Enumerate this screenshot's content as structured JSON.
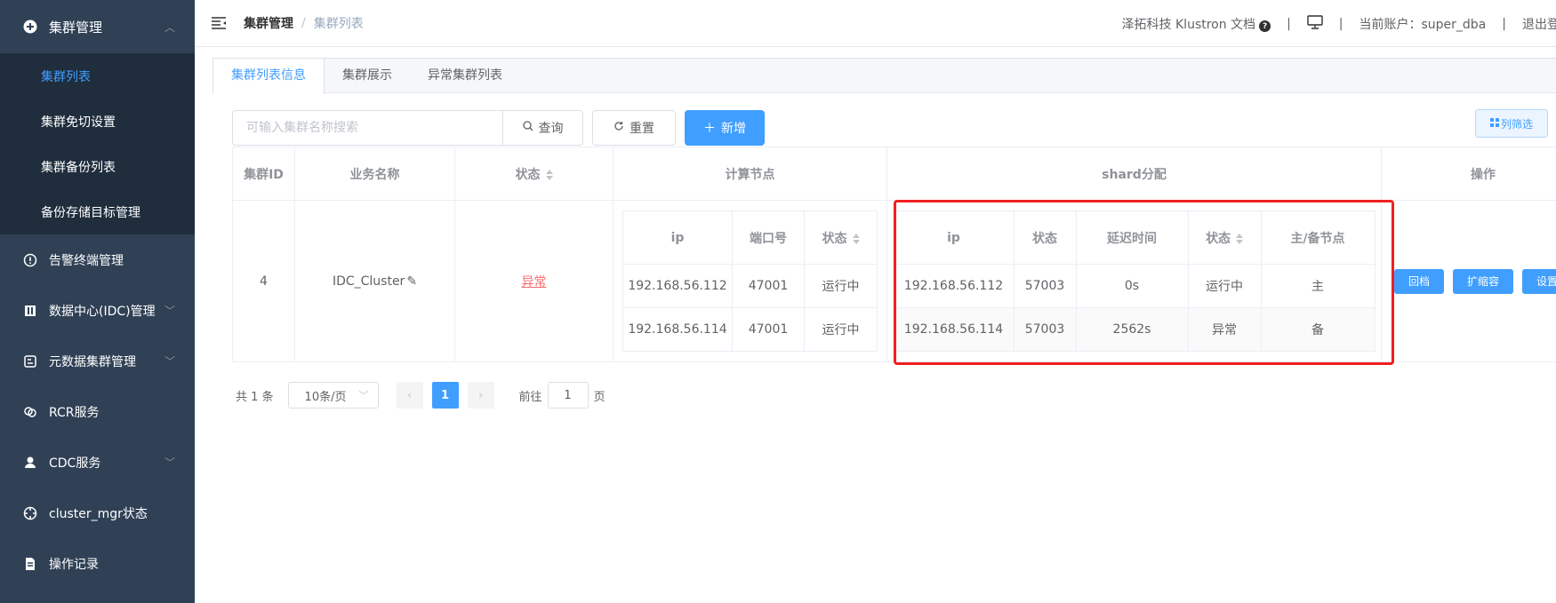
{
  "sidebar": {
    "groups": [
      {
        "label": "集群管理",
        "icon": "plus-circle-icon",
        "expanded": true,
        "items": [
          {
            "label": "集群列表",
            "active": true
          },
          {
            "label": "集群免切设置"
          },
          {
            "label": "集群备份列表"
          },
          {
            "label": "备份存储目标管理"
          }
        ]
      }
    ],
    "main_items": [
      {
        "label": "告警终端管理",
        "icon": "alert-circle-icon",
        "has_chevron": false
      },
      {
        "label": "数据中心(IDC)管理",
        "icon": "building-icon",
        "has_chevron": true
      },
      {
        "label": "元数据集群管理",
        "icon": "database-icon",
        "has_chevron": true
      },
      {
        "label": "RCR服务",
        "icon": "link-icon",
        "has_chevron": false
      },
      {
        "label": "CDC服务",
        "icon": "user-icon",
        "has_chevron": true
      },
      {
        "label": "cluster_mgr状态",
        "icon": "target-icon",
        "has_chevron": false
      },
      {
        "label": "操作记录",
        "icon": "document-icon",
        "has_chevron": false
      }
    ]
  },
  "header": {
    "breadcrumb": {
      "parent": "集群管理",
      "separator": "/",
      "current": "集群列表"
    },
    "docs_label": "泽拓科技 Klustron 文档",
    "account_label": "当前账户：super_dba",
    "logout_label": "退出登录",
    "sep": "|"
  },
  "tabs": [
    {
      "label": "集群列表信息",
      "active": true
    },
    {
      "label": "集群展示"
    },
    {
      "label": "异常集群列表"
    }
  ],
  "toolbar": {
    "search_placeholder": "可输入集群名称搜索",
    "query_label": "查询",
    "reset_label": "重置",
    "add_label": "新增",
    "filter_label": "列筛选"
  },
  "table": {
    "headers": {
      "cluster_id": "集群ID",
      "business_name": "业务名称",
      "status": "状态",
      "compute_nodes": "计算节点",
      "shard": "shard分配",
      "operations": "操作"
    },
    "compute_headers": {
      "ip": "ip",
      "port": "端口号",
      "status": "状态"
    },
    "shard_headers": {
      "ip": "ip",
      "state": "状态",
      "delay": "延迟时间",
      "status": "状态",
      "role": "主/备节点"
    },
    "row": {
      "cluster_id": "4",
      "business_name": "IDC_Cluster",
      "status": "异常",
      "compute_nodes": [
        {
          "ip": "192.168.56.112",
          "port": "47001",
          "status": "运行中"
        },
        {
          "ip": "192.168.56.114",
          "port": "47001",
          "status": "运行中"
        }
      ],
      "shards": [
        {
          "ip": "192.168.56.112",
          "state": "57003",
          "delay": "0s",
          "status": "运行中",
          "role": "主"
        },
        {
          "ip": "192.168.56.114",
          "state": "57003",
          "delay": "2562s",
          "status": "异常",
          "role": "备"
        }
      ],
      "ops": {
        "rollback": "回档",
        "scale": "扩缩容",
        "settings": "设置"
      }
    }
  },
  "pagination": {
    "total_label": "共 1 条",
    "page_size": "10条/页",
    "prev": "‹",
    "current_page": "1",
    "next": "›",
    "goto_prefix": "前往",
    "goto_value": "1",
    "goto_suffix": "页"
  },
  "colors": {
    "primary": "#409eff",
    "success": "#67c23a",
    "danger": "#f56c6c",
    "sidebar": "#304156",
    "highlight": "#f02020"
  }
}
